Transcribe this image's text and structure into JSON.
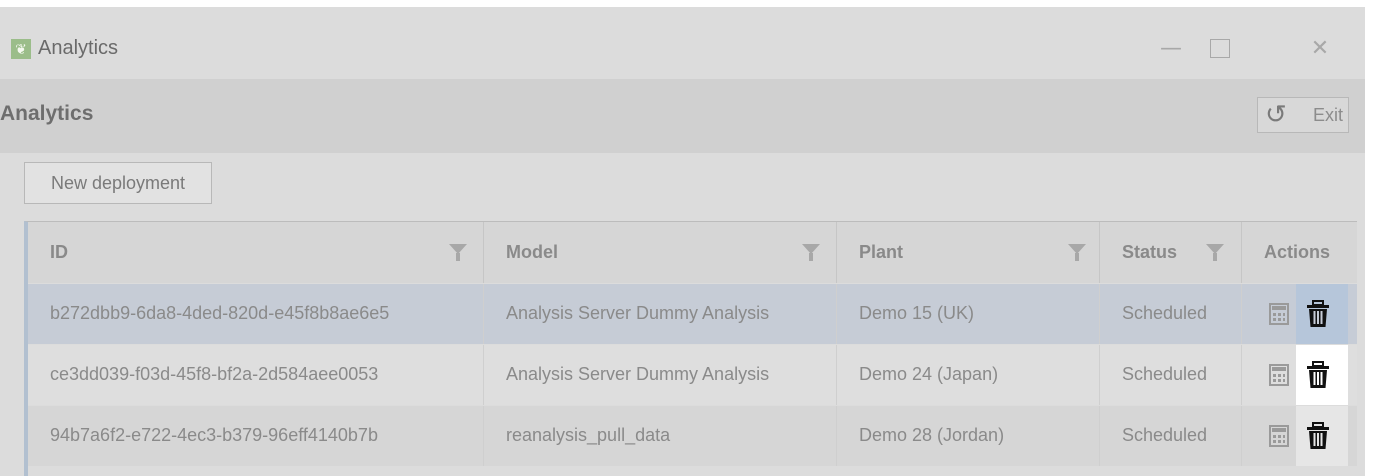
{
  "window": {
    "title": "Analytics",
    "controls": {
      "minimize": "—",
      "close": "✕"
    }
  },
  "header": {
    "title": "Analytics",
    "exit_label": "Exit"
  },
  "toolbar": {
    "new_deployment_label": "New deployment"
  },
  "table": {
    "columns": [
      "ID",
      "Model",
      "Plant",
      "Status",
      "Actions"
    ],
    "rows": [
      {
        "id": "b272dbb9-6da8-4ded-820d-e45f8b8ae6e5",
        "model": "Analysis Server Dummy Analysis",
        "plant": "Demo 15 (UK)",
        "status": "Scheduled"
      },
      {
        "id": "ce3dd039-f03d-45f8-bf2a-2d584aee0053",
        "model": "Analysis Server Dummy Analysis",
        "plant": "Demo 24 (Japan)",
        "status": "Scheduled"
      },
      {
        "id": "94b7a6f2-e722-4ec3-b379-96eff4140b7b",
        "model": "reanalysis_pull_data",
        "plant": "Demo 28 (Jordan)",
        "status": "Scheduled"
      }
    ],
    "row_actions": [
      "calculator-icon",
      "trash-icon"
    ]
  },
  "colors": {
    "window_bg": "#dcdcdc",
    "header_bg": "#d0d0d0",
    "selected_row": "#c6ccd6",
    "app_icon": "#9bbd8a",
    "grid_accent": "#b2c0d0"
  }
}
